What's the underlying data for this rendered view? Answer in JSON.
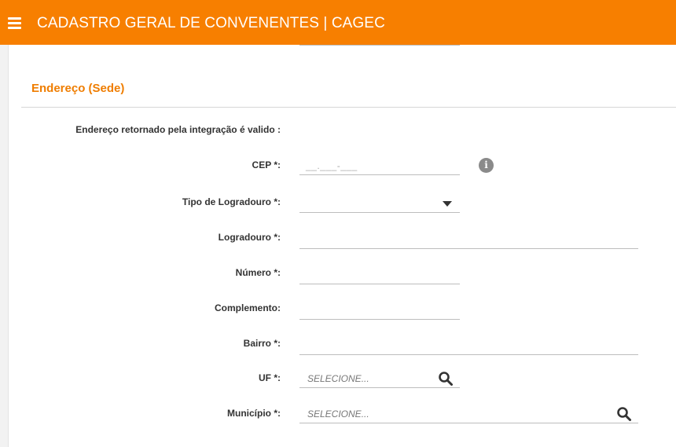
{
  "app": {
    "title": "CADASTRO GERAL DE CONVENENTES | CAGEC"
  },
  "section": {
    "title": "Endereço (Sede)"
  },
  "form": {
    "integration_note": "Endereço retornado pela integração é valido :",
    "cep": {
      "label": "CEP *:",
      "mask": "__.___-___"
    },
    "tipo_logradouro": {
      "label": "Tipo de Logradouro *:",
      "value": ""
    },
    "logradouro": {
      "label": "Logradouro *:",
      "value": ""
    },
    "numero": {
      "label": "Número *:",
      "value": ""
    },
    "complemento": {
      "label": "Complemento:",
      "value": ""
    },
    "bairro": {
      "label": "Bairro *:",
      "value": ""
    },
    "uf": {
      "label": "UF *:",
      "placeholder": "SELECIONE..."
    },
    "municipio": {
      "label": "Município *:",
      "placeholder": "SELECIONE..."
    }
  },
  "icons": {
    "menu": "hamburger-menu-icon",
    "info": "info-icon",
    "search": "search-icon",
    "dropdown": "chevron-down-icon"
  },
  "colors": {
    "header": "#f77f00",
    "section_title": "#ef7d00"
  }
}
